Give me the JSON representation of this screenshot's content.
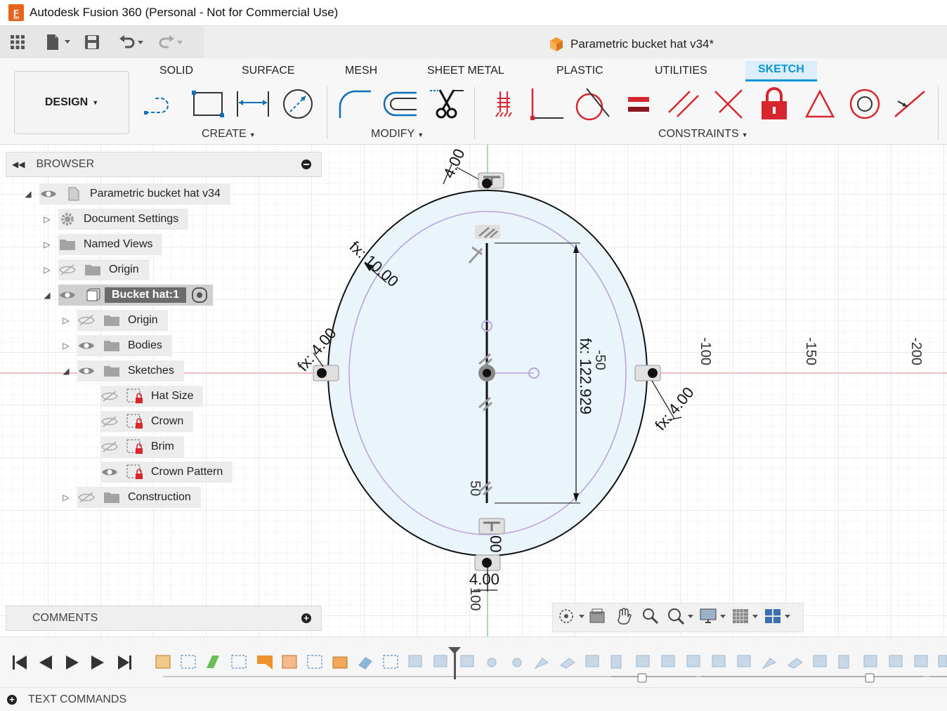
{
  "window": {
    "title": "Autodesk Fusion 360 (Personal - Not for Commercial Use)",
    "app_logo_letter": "F",
    "app_logo_sub": "360"
  },
  "document": {
    "tab_title": "Parametric bucket hat v34*"
  },
  "ribbon": {
    "workspace": "DESIGN",
    "tabs": [
      "SOLID",
      "SURFACE",
      "MESH",
      "SHEET METAL",
      "PLASTIC",
      "UTILITIES",
      "SKETCH"
    ],
    "active_tab": "SKETCH",
    "groups": {
      "create": "CREATE",
      "modify": "MODIFY",
      "constraints": "CONSTRAINTS"
    }
  },
  "browser": {
    "title": "BROWSER",
    "items": [
      {
        "label": "Parametric bucket hat v34"
      },
      {
        "label": "Document Settings"
      },
      {
        "label": "Named Views"
      },
      {
        "label": "Origin"
      },
      {
        "label": "Bucket hat:1"
      },
      {
        "label": "Origin"
      },
      {
        "label": "Bodies"
      },
      {
        "label": "Sketches"
      },
      {
        "label": "Hat Size"
      },
      {
        "label": "Crown"
      },
      {
        "label": "Brim"
      },
      {
        "label": "Crown Pattern"
      },
      {
        "label": "Construction"
      }
    ]
  },
  "sketch": {
    "dimensions": {
      "top": "4.00",
      "diag": "fx: 10.00",
      "left": "fx: 4.00",
      "right": "fx: 4.00",
      "height": "fx: 122.929",
      "bottom_a": "00",
      "bottom_b": "4.00",
      "bottom_c": "100"
    },
    "ruler": [
      "-50",
      "-100",
      "-150",
      "-200",
      "50"
    ]
  },
  "comments": {
    "title": "COMMENTS"
  },
  "text_commands": {
    "title": "TEXT COMMANDS"
  },
  "colors": {
    "accent": "#0696d7",
    "constraint_red": "#d8262f",
    "sketch_fill": "#eaf4fb",
    "sketch_inner": "#b9a4e0"
  }
}
